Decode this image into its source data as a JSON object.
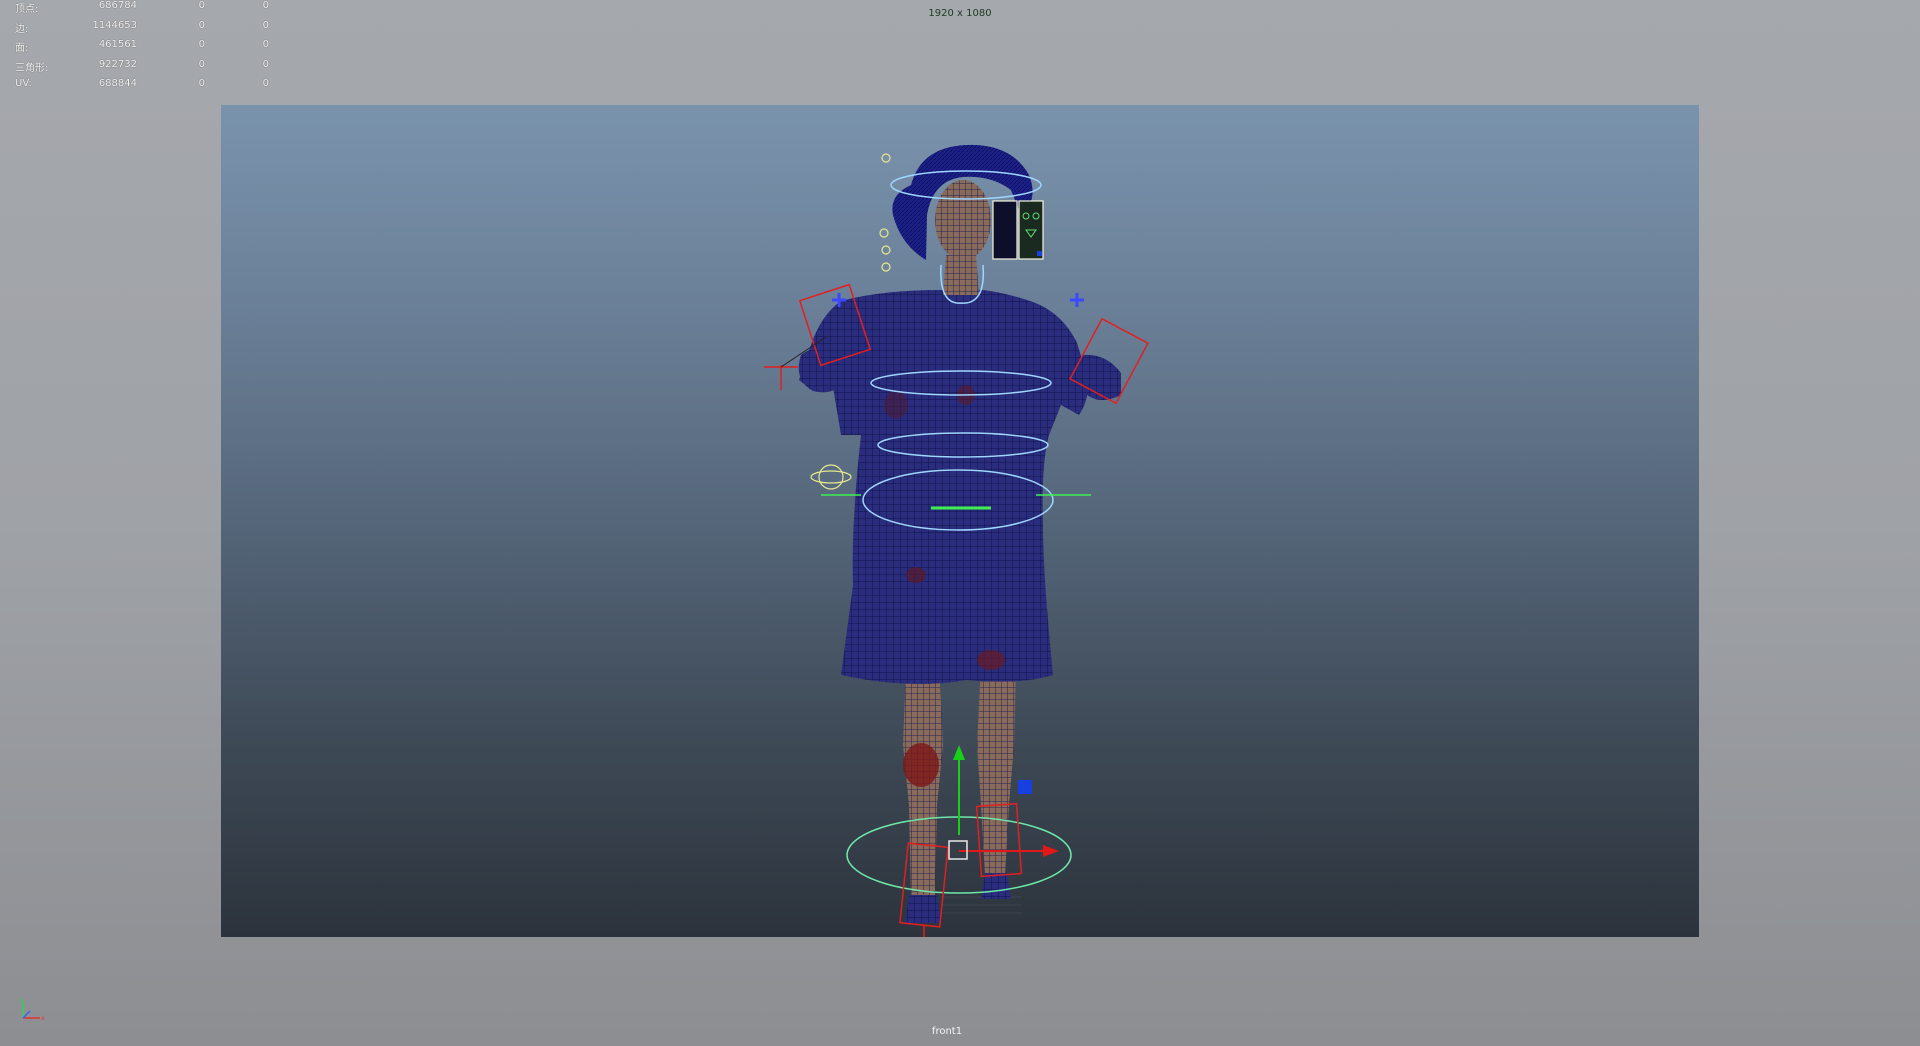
{
  "stats": [
    {
      "label": "顶点:",
      "v1": "686784",
      "v2": "0",
      "v3": "0"
    },
    {
      "label": "边:",
      "v1": "1144653",
      "v2": "0",
      "v3": "0"
    },
    {
      "label": "面:",
      "v1": "461561",
      "v2": "0",
      "v3": "0"
    },
    {
      "label": "三角形:",
      "v1": "922732",
      "v2": "0",
      "v3": "0"
    },
    {
      "label": "UV:",
      "v1": "688844",
      "v2": "0",
      "v3": "0"
    }
  ],
  "resolution_gate_label": "1920 x 1080",
  "camera_name": "front1",
  "colors": {
    "gate_top": "#7a93ad",
    "gate_bottom": "#2c333c",
    "wireframe": "#1c1e7a",
    "control_curve": "#8fd7ff",
    "ik_handle": "#e02020",
    "manip_x": "#e01818",
    "manip_y": "#18d018",
    "manip_plane": "#1840e0"
  },
  "icons": [
    "axis-indicator-icon",
    "move-manipulator-icon"
  ]
}
